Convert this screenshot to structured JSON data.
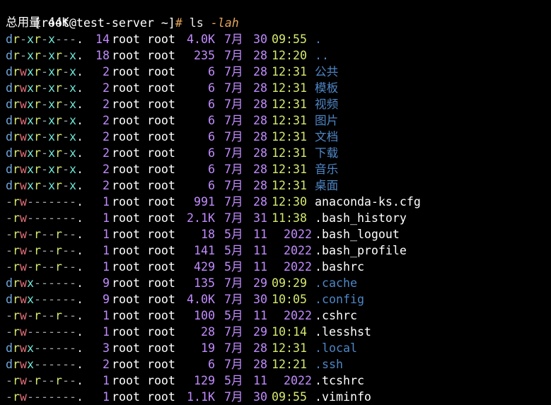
{
  "terminal": {
    "prompt": {
      "user_host": "[root@test-server ~]",
      "hash": "#",
      "command": "ls",
      "args": "-lah"
    },
    "total_line": "总用量 44K",
    "rows": [
      {
        "perm": "dr-xr-x---.",
        "links": "14",
        "owner": "root root",
        "size": "4.0K",
        "month": "7月",
        "day": "30",
        "time": "09:55",
        "year": "",
        "name": ".",
        "type": "dir"
      },
      {
        "perm": "dr-xr-xr-x.",
        "links": "18",
        "owner": "root root",
        "size": "235",
        "month": "7月",
        "day": "28",
        "time": "12:20",
        "year": "",
        "name": "..",
        "type": "dir"
      },
      {
        "perm": "drwxr-xr-x.",
        "links": "2",
        "owner": "root root",
        "size": "6",
        "month": "7月",
        "day": "28",
        "time": "12:31",
        "year": "",
        "name": "公共",
        "type": "dir"
      },
      {
        "perm": "drwxr-xr-x.",
        "links": "2",
        "owner": "root root",
        "size": "6",
        "month": "7月",
        "day": "28",
        "time": "12:31",
        "year": "",
        "name": "模板",
        "type": "dir"
      },
      {
        "perm": "drwxr-xr-x.",
        "links": "2",
        "owner": "root root",
        "size": "6",
        "month": "7月",
        "day": "28",
        "time": "12:31",
        "year": "",
        "name": "视频",
        "type": "dir"
      },
      {
        "perm": "drwxr-xr-x.",
        "links": "2",
        "owner": "root root",
        "size": "6",
        "month": "7月",
        "day": "28",
        "time": "12:31",
        "year": "",
        "name": "图片",
        "type": "dir"
      },
      {
        "perm": "drwxr-xr-x.",
        "links": "2",
        "owner": "root root",
        "size": "6",
        "month": "7月",
        "day": "28",
        "time": "12:31",
        "year": "",
        "name": "文档",
        "type": "dir"
      },
      {
        "perm": "drwxr-xr-x.",
        "links": "2",
        "owner": "root root",
        "size": "6",
        "month": "7月",
        "day": "28",
        "time": "12:31",
        "year": "",
        "name": "下载",
        "type": "dir"
      },
      {
        "perm": "drwxr-xr-x.",
        "links": "2",
        "owner": "root root",
        "size": "6",
        "month": "7月",
        "day": "28",
        "time": "12:31",
        "year": "",
        "name": "音乐",
        "type": "dir"
      },
      {
        "perm": "drwxr-xr-x.",
        "links": "2",
        "owner": "root root",
        "size": "6",
        "month": "7月",
        "day": "28",
        "time": "12:31",
        "year": "",
        "name": "桌面",
        "type": "dir"
      },
      {
        "perm": "-rw-------.",
        "links": "1",
        "owner": "root root",
        "size": "991",
        "month": "7月",
        "day": "28",
        "time": "12:30",
        "year": "",
        "name": "anaconda-ks.cfg",
        "type": "file"
      },
      {
        "perm": "-rw-------.",
        "links": "1",
        "owner": "root root",
        "size": "2.1K",
        "month": "7月",
        "day": "31",
        "time": "11:38",
        "year": "",
        "name": ".bash_history",
        "type": "file"
      },
      {
        "perm": "-rw-r--r--.",
        "links": "1",
        "owner": "root root",
        "size": "18",
        "month": "5月",
        "day": "11",
        "time": "",
        "year": "2022",
        "name": ".bash_logout",
        "type": "file"
      },
      {
        "perm": "-rw-r--r--.",
        "links": "1",
        "owner": "root root",
        "size": "141",
        "month": "5月",
        "day": "11",
        "time": "",
        "year": "2022",
        "name": ".bash_profile",
        "type": "file"
      },
      {
        "perm": "-rw-r--r--.",
        "links": "1",
        "owner": "root root",
        "size": "429",
        "month": "5月",
        "day": "11",
        "time": "",
        "year": "2022",
        "name": ".bashrc",
        "type": "file"
      },
      {
        "perm": "drwx------.",
        "links": "9",
        "owner": "root root",
        "size": "135",
        "month": "7月",
        "day": "29",
        "time": "09:29",
        "year": "",
        "name": ".cache",
        "type": "dir"
      },
      {
        "perm": "drwx------.",
        "links": "9",
        "owner": "root root",
        "size": "4.0K",
        "month": "7月",
        "day": "30",
        "time": "10:05",
        "year": "",
        "name": ".config",
        "type": "dir"
      },
      {
        "perm": "-rw-r--r--.",
        "links": "1",
        "owner": "root root",
        "size": "100",
        "month": "5月",
        "day": "11",
        "time": "",
        "year": "2022",
        "name": ".cshrc",
        "type": "file"
      },
      {
        "perm": "-rw-------.",
        "links": "1",
        "owner": "root root",
        "size": "28",
        "month": "7月",
        "day": "29",
        "time": "10:14",
        "year": "",
        "name": ".lesshst",
        "type": "file"
      },
      {
        "perm": "drwx------.",
        "links": "3",
        "owner": "root root",
        "size": "19",
        "month": "7月",
        "day": "28",
        "time": "12:31",
        "year": "",
        "name": ".local",
        "type": "dir"
      },
      {
        "perm": "drwx------.",
        "links": "2",
        "owner": "root root",
        "size": "6",
        "month": "7月",
        "day": "28",
        "time": "12:21",
        "year": "",
        "name": ".ssh",
        "type": "dir"
      },
      {
        "perm": "-rw-r--r--.",
        "links": "1",
        "owner": "root root",
        "size": "129",
        "month": "5月",
        "day": "11",
        "time": "",
        "year": "2022",
        "name": ".tcshrc",
        "type": "file"
      },
      {
        "perm": "-rw-------.",
        "links": "1",
        "owner": "root root",
        "size": "1.1K",
        "month": "7月",
        "day": "30",
        "time": "09:55",
        "year": "",
        "name": ".viminfo",
        "type": "file"
      }
    ]
  },
  "colors": {
    "background": "#000000",
    "directory": "#4f86c6",
    "number": "#c28bff",
    "time": "#d7e86e",
    "prompt_hash": "#e5a55a"
  }
}
